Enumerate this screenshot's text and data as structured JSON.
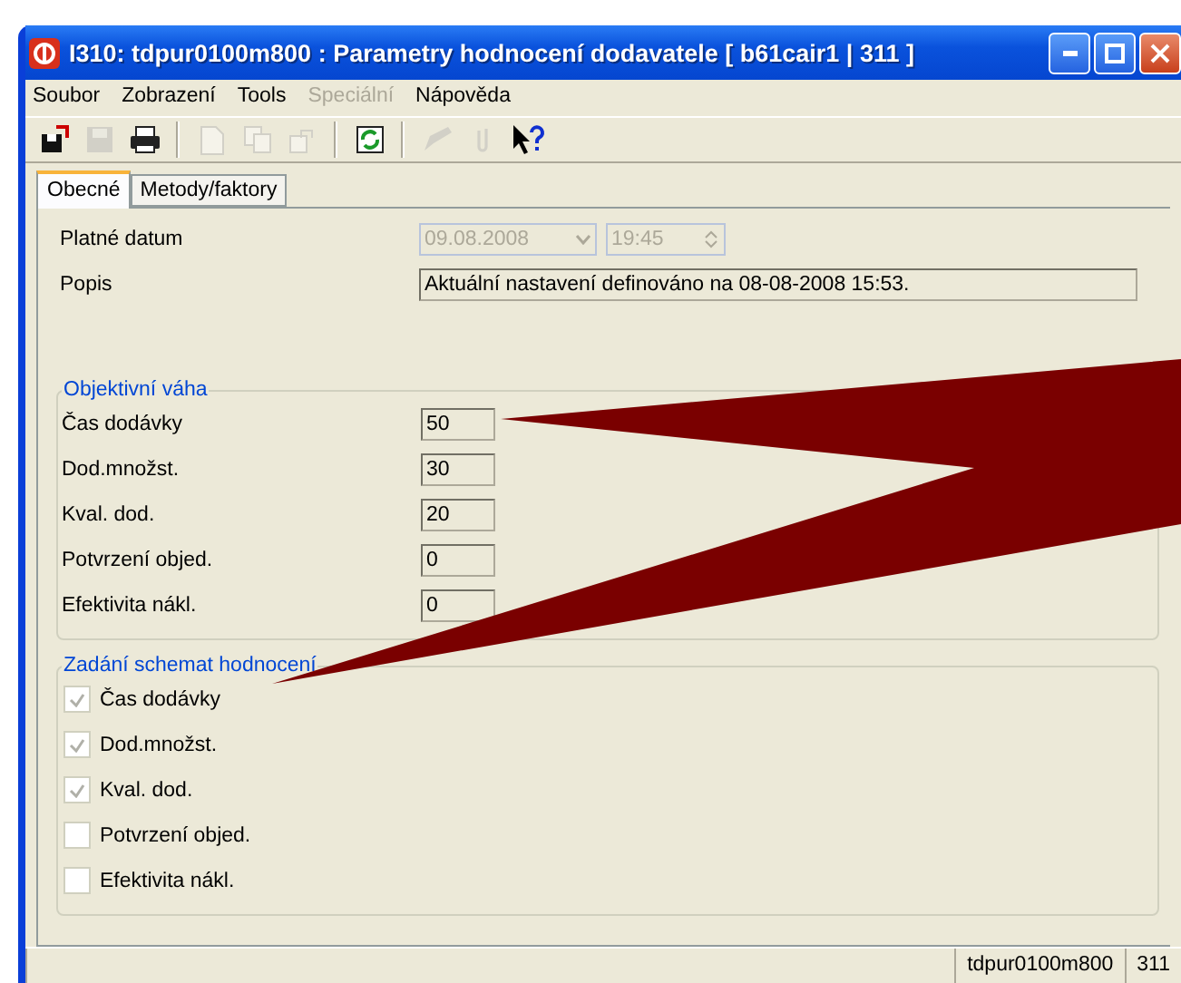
{
  "window": {
    "title": "I310: tdpur0100m800 : Parametry hodnocení dodavatele [ b61cair1 | 311 ]"
  },
  "menu": [
    {
      "label": "Soubor",
      "disabled": false
    },
    {
      "label": "Zobrazení",
      "disabled": false
    },
    {
      "label": "Tools",
      "disabled": false
    },
    {
      "label": "Speciální",
      "disabled": true
    },
    {
      "label": "Nápověda",
      "disabled": false
    }
  ],
  "toolbar": [
    {
      "kind": "exit",
      "disabled": false
    },
    {
      "kind": "save",
      "disabled": true
    },
    {
      "kind": "print",
      "disabled": false
    },
    {
      "kind": "separator"
    },
    {
      "kind": "new",
      "disabled": true
    },
    {
      "kind": "copy",
      "disabled": true
    },
    {
      "kind": "export",
      "disabled": true
    },
    {
      "kind": "separator"
    },
    {
      "kind": "refresh",
      "disabled": false
    },
    {
      "kind": "separator"
    },
    {
      "kind": "edit",
      "disabled": true
    },
    {
      "kind": "attach",
      "disabled": true
    },
    {
      "kind": "help",
      "disabled": false
    }
  ],
  "tabs": [
    {
      "label": "Obecné",
      "selected": true
    },
    {
      "label": "Metody/faktory",
      "selected": false
    }
  ],
  "fields": {
    "date_label": "Platné datum",
    "date": "09.08.2008",
    "time": "19:45",
    "description_label": "Popis",
    "description": "Aktuální nastavení definováno na 08-08-2008 15:53."
  },
  "weights": {
    "title": "Objektivní váha",
    "rows": [
      {
        "label": "Čas dodávky",
        "value": "50"
      },
      {
        "label": "Dod.množst.",
        "value": "30"
      },
      {
        "label": "Kval. dod.",
        "value": "20"
      },
      {
        "label": "Potvrzení objed.",
        "value": "0"
      },
      {
        "label": "Efektivita nákl.",
        "value": "0"
      }
    ]
  },
  "schemes": {
    "title": "Zadání schemat hodnocení",
    "items": [
      {
        "label": "Čas dodávky",
        "checked": true
      },
      {
        "label": "Dod.množst.",
        "checked": true
      },
      {
        "label": "Kval. dod.",
        "checked": true
      },
      {
        "label": "Potvrzení objed.",
        "checked": false
      },
      {
        "label": "Efektivita nákl.",
        "checked": false
      }
    ]
  },
  "status_bar": [
    "tdpur0100m800",
    "311"
  ]
}
